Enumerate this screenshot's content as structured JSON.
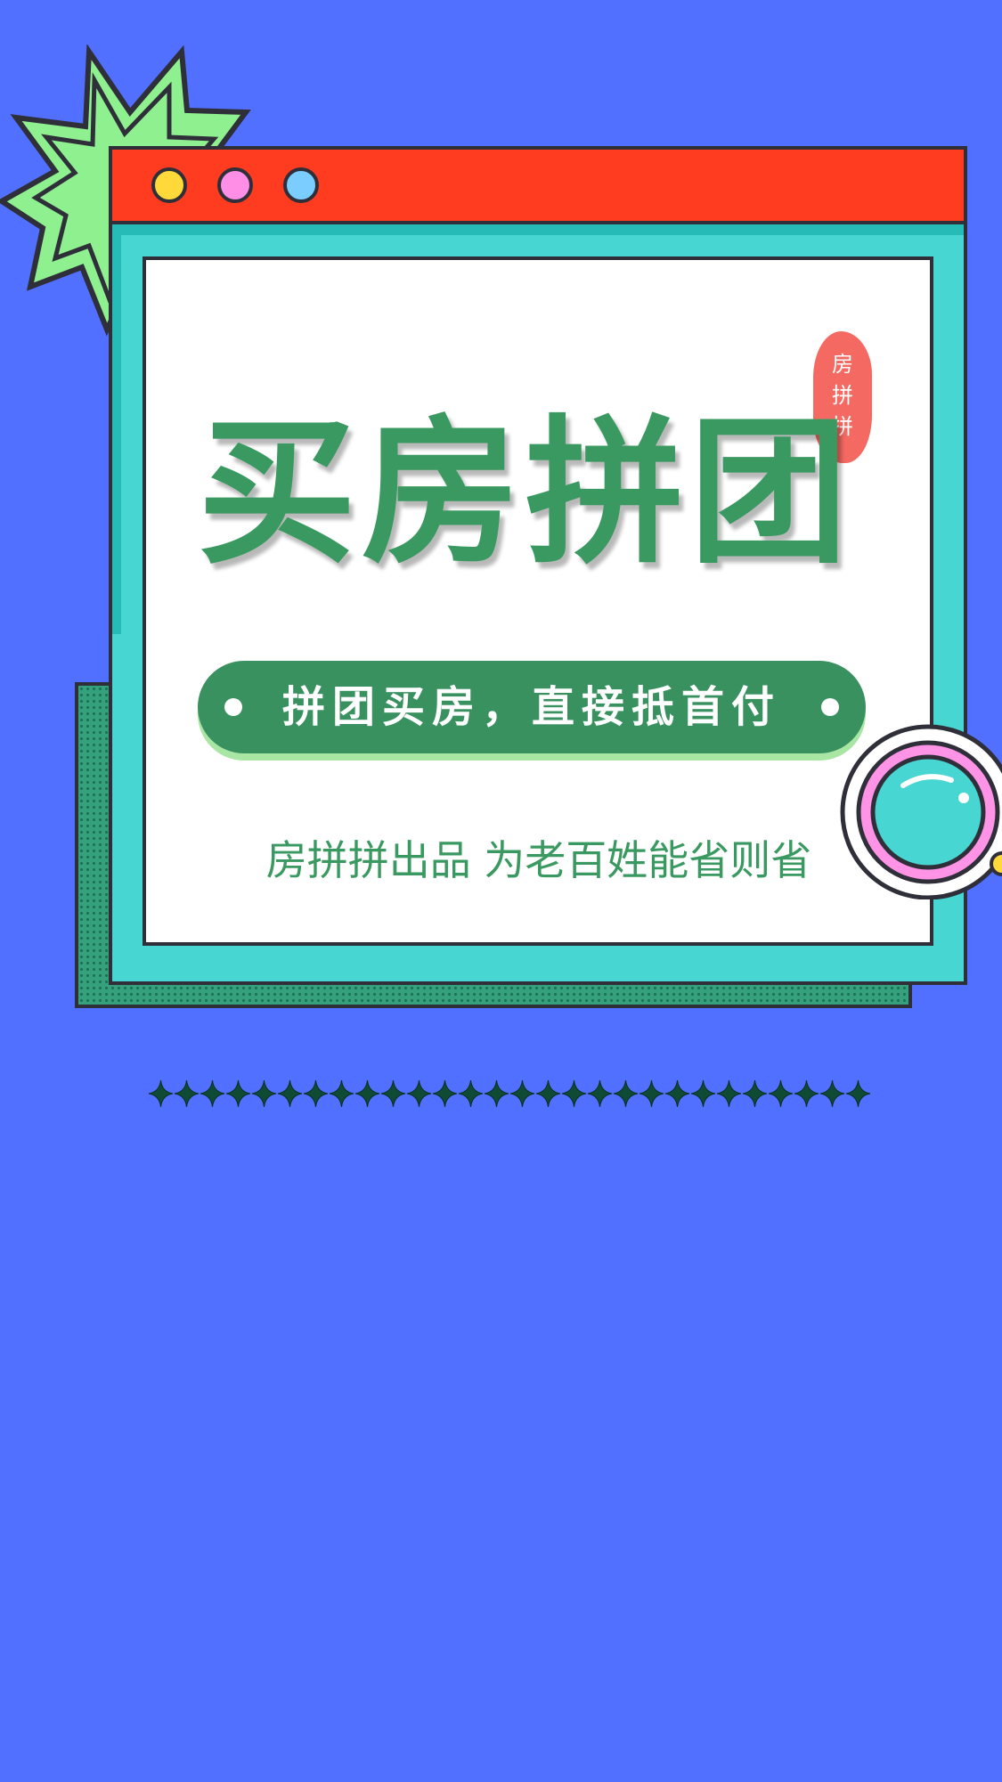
{
  "poster": {
    "title": "买房拼团",
    "stamp": [
      "房",
      "拼",
      "拼"
    ],
    "tagline": "拼团买房，直接抵首付",
    "slogan": "房拼拼出品 为老百姓能省则省"
  },
  "colors": {
    "background": "#5170ff",
    "titlebar": "#ff3c20",
    "window": "#48d6d2",
    "accent_green": "#3a9160",
    "starburst": "#8ef08e",
    "stamp": "#f46a62",
    "outline": "#2f2f3a"
  },
  "window_controls": [
    "yellow-dot",
    "pink-dot",
    "blue-dot"
  ],
  "decorations": {
    "diamond_count": 28,
    "icons": [
      "starburst-icon",
      "magnifier-icon",
      "diamond-icon"
    ]
  }
}
